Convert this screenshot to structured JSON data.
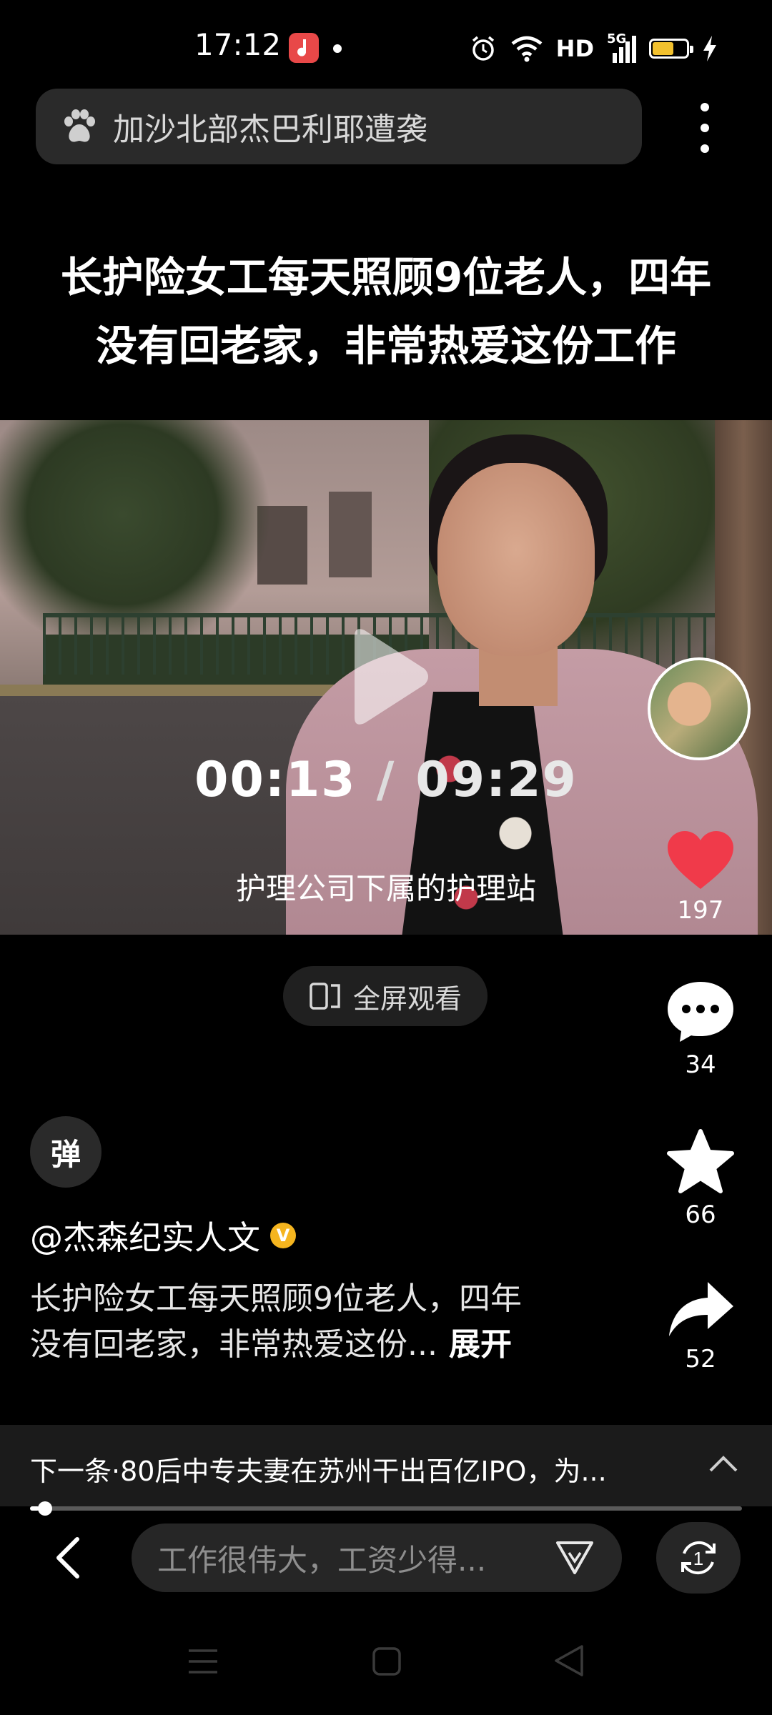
{
  "status_bar": {
    "time": "17:12",
    "network_label": "HD",
    "signal_label": "5G",
    "battery_level": 0.62,
    "colors": {
      "battery": "#f2c12e",
      "app_icon": "#e84848"
    }
  },
  "search": {
    "query": "加沙北部杰巴利耶遭袭",
    "icon": "baidu-paw-icon"
  },
  "headline": {
    "line1": "长护险女工每天照顾9位老人，四年",
    "line2": "没有回老家，非常热爱这份工作"
  },
  "video": {
    "current_time": "00:13",
    "separator": "/",
    "total_time": "09:29",
    "caption": "护理公司下属的护理站"
  },
  "actions": {
    "likes": "197",
    "comments": "34",
    "favorites": "66",
    "shares": "52",
    "colors": {
      "like": "#f03a4a"
    }
  },
  "fullscreen": {
    "label": "全屏观看"
  },
  "danmaku": {
    "label": "弹"
  },
  "author": {
    "name": "@杰森纪实人文",
    "verified_mark": "V",
    "colors": {
      "verified": "#f5b51f"
    }
  },
  "description": {
    "line1": "长护险女工每天照顾9位老人，四年",
    "line2": "没有回老家，非常热爱这份...",
    "expand_label": "展开"
  },
  "next": {
    "text": "下一条·80后中专夫妻在苏州干出百亿IPO，为...",
    "progress": 0.013
  },
  "bottom": {
    "comment_placeholder": "工作很伟大，工资少得...",
    "page_number": "1"
  }
}
